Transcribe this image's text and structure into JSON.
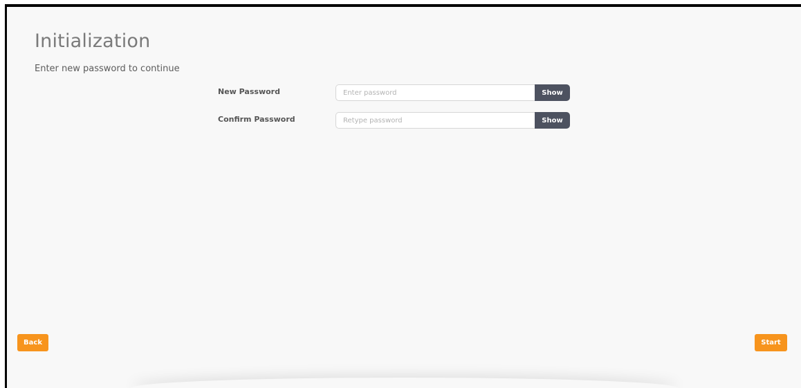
{
  "page": {
    "title": "Initialization",
    "subtitle": "Enter new password to continue"
  },
  "form": {
    "new_password": {
      "label": "New Password",
      "placeholder": "Enter password",
      "value": "",
      "show_label": "Show"
    },
    "confirm_password": {
      "label": "Confirm Password",
      "placeholder": "Retype password",
      "value": "",
      "show_label": "Show"
    }
  },
  "nav": {
    "back_label": "Back",
    "start_label": "Start"
  },
  "colors": {
    "accent": "#f7941d",
    "show_button": "#4d5260",
    "background": "#f8f8f8"
  }
}
